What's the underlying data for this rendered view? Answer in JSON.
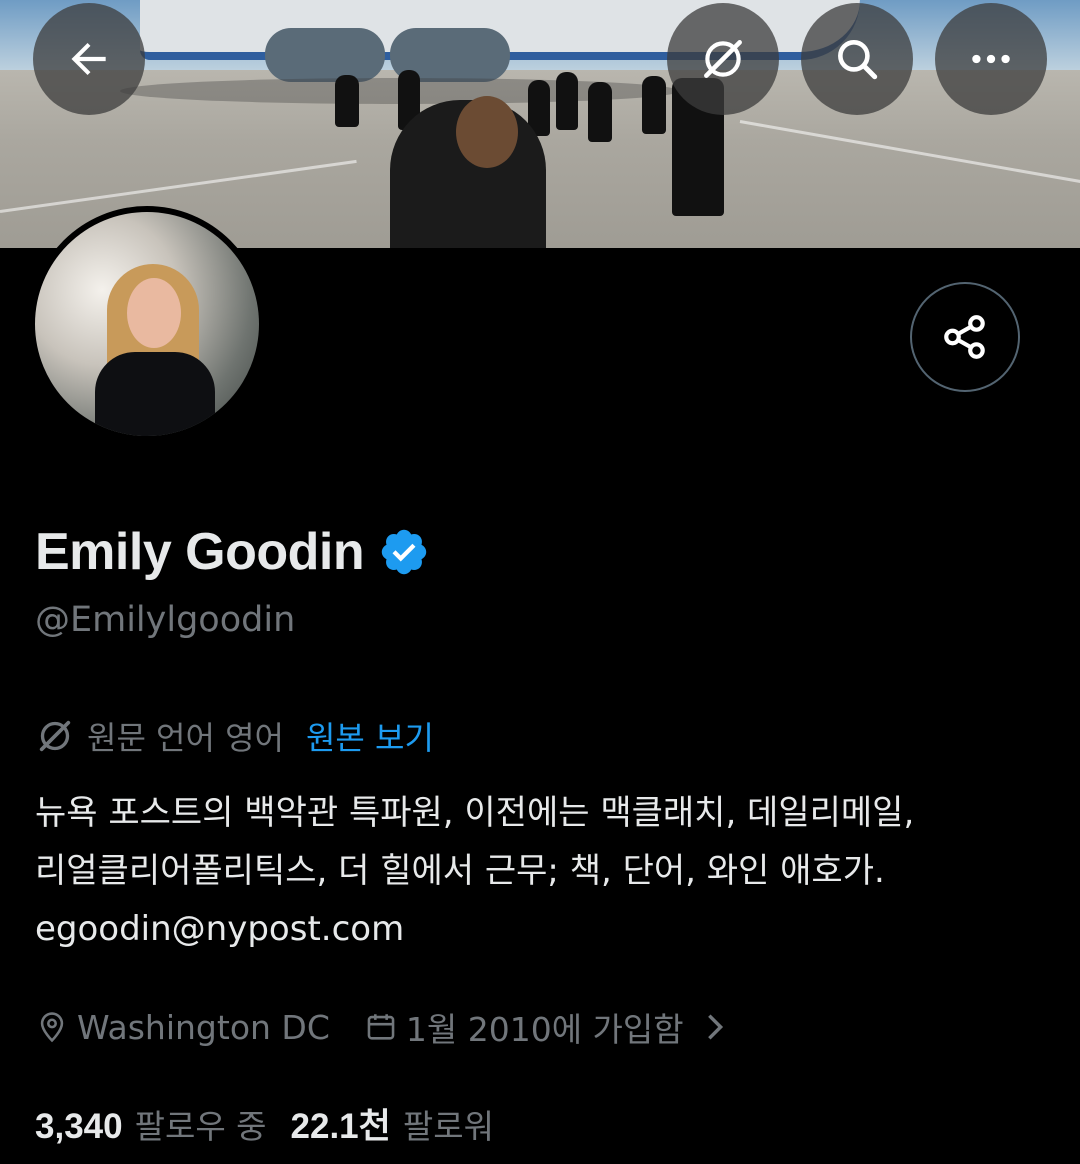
{
  "profile": {
    "name": "Emily Goodin",
    "handle": "@Emilylgoodin",
    "verified_color": "#1d9bf0"
  },
  "translate": {
    "language_text": "원문 언어 영어",
    "view_original": "원본 보기"
  },
  "bio": "뉴욕 포스트의 백악관 특파원, 이전에는 맥클래치, 데일리메일,\n리얼클리어폴리틱스, 더 힐에서 근무; 책, 단어, 와인 애호가.\negoodin@nypost.com",
  "meta": {
    "location": "Washington DC",
    "joined": "1월 2010에 가입함"
  },
  "stats": {
    "following_count": "3,340",
    "following_label": "팔로우 중",
    "followers_count": "22.1천",
    "followers_label": "팔로워"
  },
  "icons": {
    "back": "arrow-left-icon",
    "translate": "translate-icon",
    "search": "search-icon",
    "more": "more-icon",
    "share": "share-icon",
    "location": "location-pin-icon",
    "calendar": "calendar-icon"
  },
  "colors": {
    "background": "#000000",
    "text": "#e7e9ea",
    "secondary": "#71767b",
    "accent": "#1d9bf0"
  }
}
